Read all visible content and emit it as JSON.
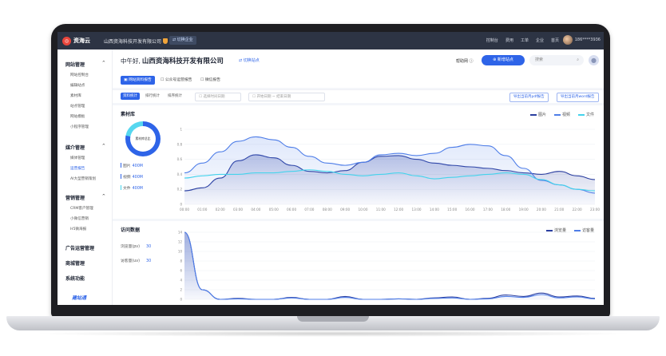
{
  "topbar": {
    "logo": "资海云",
    "company": "山西资海科技开发有限公司",
    "switch_label": "切换企业",
    "nav": [
      "控制台",
      "费用",
      "工单",
      "企业",
      "首页"
    ],
    "user_phone": "186****3936"
  },
  "sidebar": {
    "groups": [
      {
        "label": "网站管理",
        "items": [
          "网站控制台",
          "编辑站点",
          "素材库",
          "站点管理",
          "网站模板",
          "小程序管理"
        ]
      },
      {
        "label": "媒介管理",
        "items": [
          "媒体管理",
          "运营报告",
          "AI大型营销策划"
        ]
      },
      {
        "label": "营销管理",
        "items": [
          "CRM客户管理",
          "小微信营销",
          "H5微海报"
        ]
      },
      {
        "label": "广告运营管理",
        "items": []
      },
      {
        "label": "商城管理",
        "items": []
      },
      {
        "label": "系统功能",
        "items": []
      }
    ],
    "active_item": "运营报告",
    "footer_logo": "建站通"
  },
  "header": {
    "greeting": "中午好,",
    "company": "山西资海科技开发有限公司",
    "switch_site": "切换站点",
    "help": "帮助网",
    "new_site": "新增站点",
    "search_placeholder": "搜索",
    "tabs": [
      "网站资料报告",
      "公众号运营报告",
      "微信报告"
    ]
  },
  "filters": {
    "chips": [
      "资料统计",
      "排行统计",
      "排序统计"
    ],
    "date_select": "选择时间日期",
    "start_date": "开始日期",
    "range_sep": "~",
    "end_date": "结束日期",
    "export_pdf": "导出当前月pdf报告",
    "export_word": "导出当前月word报告"
  },
  "material": {
    "title": "素材库",
    "donut_label": "素材库总比",
    "stats": [
      {
        "label": "图片",
        "value": "400M"
      },
      {
        "label": "视频",
        "value": "400M"
      },
      {
        "label": "文件",
        "value": "400M"
      }
    ],
    "legend": [
      "图片",
      "视频",
      "文件"
    ]
  },
  "visits": {
    "title": "访问数据",
    "stats": [
      {
        "label": "浏览量(pv)",
        "value": "30"
      },
      {
        "label": "访客量(uv)",
        "value": "30"
      }
    ],
    "legend": [
      "浏览量",
      "访客量"
    ]
  },
  "colors": {
    "accent": "#2e64e8",
    "topbar": "#2d3444",
    "series_image": "#2b3fa0",
    "series_video": "#4f7ee8",
    "series_file": "#44d3ec"
  },
  "chart_data": [
    {
      "type": "line",
      "categories": [
        "00:00",
        "01:00",
        "02:00",
        "03:00",
        "04:00",
        "05:00",
        "06:00",
        "07:00",
        "08:00",
        "09:00",
        "10:00",
        "11:00",
        "12:00",
        "13:00",
        "14:00",
        "15:00",
        "16:00",
        "17:00",
        "18:00",
        "19:00",
        "20:00",
        "21:00",
        "22:00",
        "23:00"
      ],
      "ylim": [
        0,
        1
      ],
      "yticks": [
        "0",
        "0.2",
        "0.4",
        "0.6",
        "0.8",
        "1"
      ],
      "series": [
        {
          "name": "图片",
          "values": [
            0.18,
            0.22,
            0.35,
            0.58,
            0.66,
            0.62,
            0.52,
            0.44,
            0.42,
            0.45,
            0.56,
            0.64,
            0.65,
            0.6,
            0.55,
            0.52,
            0.5,
            0.48,
            0.45,
            0.42,
            0.4,
            0.44,
            0.38,
            0.33
          ]
        },
        {
          "name": "视频",
          "values": [
            0.42,
            0.55,
            0.7,
            0.84,
            0.9,
            0.86,
            0.76,
            0.64,
            0.55,
            0.52,
            0.56,
            0.66,
            0.68,
            0.65,
            0.68,
            0.76,
            0.8,
            0.78,
            0.65,
            0.48,
            0.32,
            0.26,
            0.2,
            0.15
          ]
        },
        {
          "name": "文件",
          "values": [
            0.35,
            0.38,
            0.4,
            0.4,
            0.42,
            0.42,
            0.44,
            0.46,
            0.44,
            0.4,
            0.38,
            0.4,
            0.42,
            0.38,
            0.34,
            0.36,
            0.38,
            0.4,
            0.42,
            0.4,
            0.33,
            0.26,
            0.2,
            0.18
          ]
        }
      ]
    },
    {
      "type": "area",
      "categories": [
        "00:00",
        "01:00",
        "02:00",
        "03:00",
        "04:00",
        "05:00",
        "06:00",
        "07:00",
        "08:00",
        "09:00",
        "10:00",
        "11:00",
        "12:00",
        "13:00",
        "14:00",
        "15:00",
        "16:00",
        "17:00",
        "18:00",
        "19:00",
        "20:00",
        "21:00",
        "22:00",
        "23:00"
      ],
      "ylim": [
        0,
        14
      ],
      "yticks": [
        "0",
        "2",
        "4",
        "6",
        "8",
        "10",
        "12",
        "14"
      ],
      "series": [
        {
          "name": "浏览量",
          "values": [
            14,
            2,
            0,
            0.2,
            0,
            0,
            0.4,
            0,
            0,
            0.6,
            0,
            0,
            0.1,
            0,
            0.3,
            0.5,
            0,
            0.2,
            0.9,
            0.6,
            1.3,
            0.5,
            0.7,
            0.2
          ]
        },
        {
          "name": "访客量",
          "values": [
            14,
            2,
            0,
            0.1,
            0,
            0,
            0.3,
            0,
            0,
            0.4,
            0,
            0,
            0.1,
            0,
            0.2,
            0.3,
            0,
            0.1,
            0.6,
            0.4,
            1.0,
            0.3,
            0.5,
            0.1
          ]
        }
      ]
    }
  ]
}
